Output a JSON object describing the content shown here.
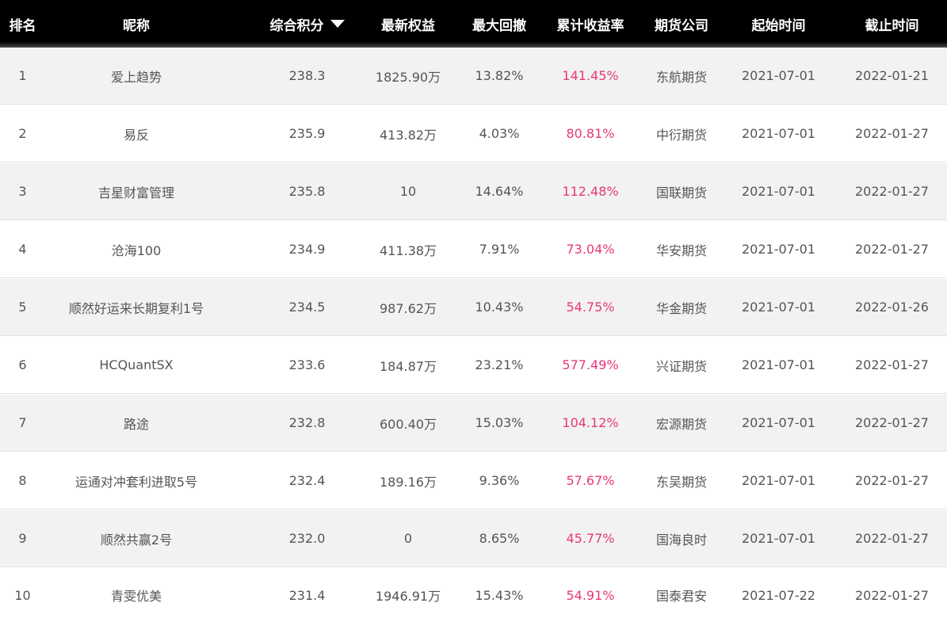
{
  "colors": {
    "header_bg": "#000000",
    "header_text": "#ffffff",
    "row_alt_bg": "#f2f2f2",
    "text": "#555555",
    "return_accent": "#e8387a"
  },
  "header": {
    "rank": "排名",
    "name": "昵称",
    "score": "综合积分",
    "equity": "最新权益",
    "drawdown": "最大回撤",
    "return": "累计收益率",
    "company": "期货公司",
    "start": "起始时间",
    "end": "截止时间",
    "sort_icon": "caret-down-icon"
  },
  "rows": [
    {
      "rank": "1",
      "name": "爱上趋势",
      "score": "238.3",
      "equity": "1825.90万",
      "drawdown": "13.82%",
      "return": "141.45%",
      "company": "东航期货",
      "start": "2021-07-01",
      "end": "2022-01-21"
    },
    {
      "rank": "2",
      "name": "易反",
      "score": "235.9",
      "equity": "413.82万",
      "drawdown": "4.03%",
      "return": "80.81%",
      "company": "中衍期货",
      "start": "2021-07-01",
      "end": "2022-01-27"
    },
    {
      "rank": "3",
      "name": "吉星财富管理",
      "score": "235.8",
      "equity": "10",
      "drawdown": "14.64%",
      "return": "112.48%",
      "company": "国联期货",
      "start": "2021-07-01",
      "end": "2022-01-27"
    },
    {
      "rank": "4",
      "name": "沧海100",
      "score": "234.9",
      "equity": "411.38万",
      "drawdown": "7.91%",
      "return": "73.04%",
      "company": "华安期货",
      "start": "2021-07-01",
      "end": "2022-01-27"
    },
    {
      "rank": "5",
      "name": "顺然好运来长期复利1号",
      "score": "234.5",
      "equity": "987.62万",
      "drawdown": "10.43%",
      "return": "54.75%",
      "company": "华金期货",
      "start": "2021-07-01",
      "end": "2022-01-26"
    },
    {
      "rank": "6",
      "name": "HCQuantSX",
      "score": "233.6",
      "equity": "184.87万",
      "drawdown": "23.21%",
      "return": "577.49%",
      "company": "兴证期货",
      "start": "2021-07-01",
      "end": "2022-01-27"
    },
    {
      "rank": "7",
      "name": "路途",
      "score": "232.8",
      "equity": "600.40万",
      "drawdown": "15.03%",
      "return": "104.12%",
      "company": "宏源期货",
      "start": "2021-07-01",
      "end": "2022-01-27"
    },
    {
      "rank": "8",
      "name": "运通对冲套利进取5号",
      "score": "232.4",
      "equity": "189.16万",
      "drawdown": "9.36%",
      "return": "57.67%",
      "company": "东吴期货",
      "start": "2021-07-01",
      "end": "2022-01-27"
    },
    {
      "rank": "9",
      "name": "顺然共赢2号",
      "score": "232.0",
      "equity": "0",
      "drawdown": "8.65%",
      "return": "45.77%",
      "company": "国海良时",
      "start": "2021-07-01",
      "end": "2022-01-27"
    },
    {
      "rank": "10",
      "name": "青雯优美",
      "score": "231.4",
      "equity": "1946.91万",
      "drawdown": "15.43%",
      "return": "54.91%",
      "company": "国泰君安",
      "start": "2021-07-22",
      "end": "2022-01-27"
    }
  ]
}
